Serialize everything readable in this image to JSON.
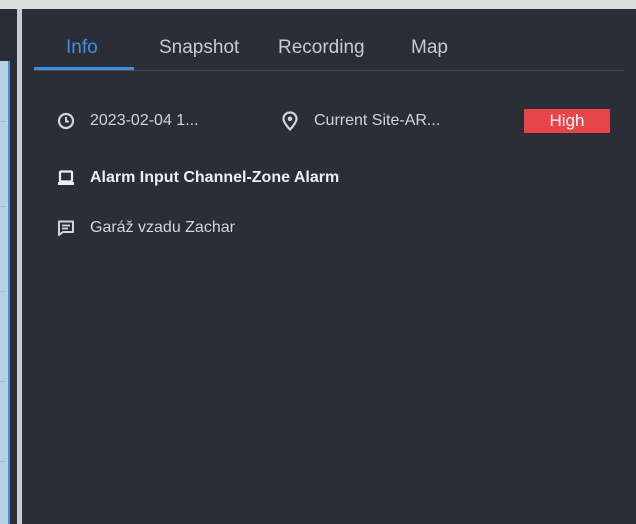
{
  "tabs": [
    {
      "label": "Info",
      "active": true
    },
    {
      "label": "Snapshot",
      "active": false
    },
    {
      "label": "Recording",
      "active": false
    },
    {
      "label": "Map",
      "active": false
    }
  ],
  "info": {
    "time": "2023-02-04 1...",
    "site": "Current Site-AR...",
    "priority": "High",
    "source": "Alarm Input Channel-Zone Alarm",
    "remark": "Garáž vzadu Zachar"
  },
  "colors": {
    "accent": "#3f8ee0",
    "priority_high": "#e8454b",
    "background": "#2b2e37"
  }
}
